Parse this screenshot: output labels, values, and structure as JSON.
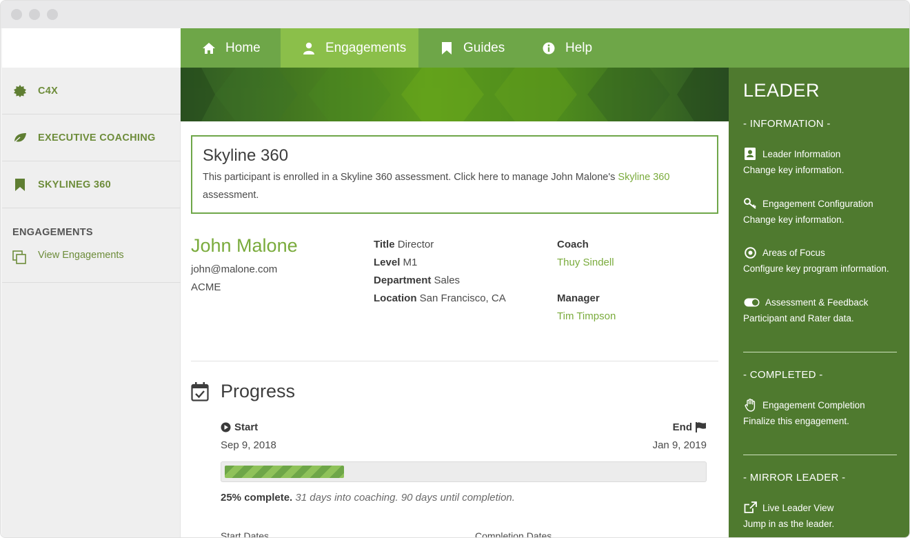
{
  "sidebar": {
    "items": [
      {
        "label": "C4X",
        "icon": "badge-icon"
      },
      {
        "label": "EXECUTIVE COACHING",
        "icon": "leaf-icon"
      },
      {
        "label": "SKYLINEG 360",
        "icon": "bookmark-icon"
      }
    ],
    "section_heading": "ENGAGEMENTS",
    "view_link": "View Engagements"
  },
  "nav": {
    "tabs": [
      {
        "label": "Home",
        "icon": "home-icon"
      },
      {
        "label": "Engagements",
        "icon": "user-icon",
        "active": true
      },
      {
        "label": "Guides",
        "icon": "bookmark-icon"
      },
      {
        "label": "Help",
        "icon": "info-icon"
      }
    ]
  },
  "notice": {
    "title": "Skyline 360",
    "text": "This participant is enrolled in a Skyline 360 assessment. Click here to manage John Malone's ",
    "link": "Skyline 360",
    "text_after": "assessment."
  },
  "person": {
    "name": "John Malone",
    "email": "john@malone.com",
    "company": "ACME",
    "fields": [
      {
        "key": "Title",
        "value": "Director"
      },
      {
        "key": "Level",
        "value": "M1"
      },
      {
        "key": "Department",
        "value": "Sales"
      },
      {
        "key": "Location",
        "value": "San Francisco, CA"
      }
    ],
    "coach_label": "Coach",
    "coach": "Thuy Sindell",
    "manager_label": "Manager",
    "manager": "Tim Timpson"
  },
  "progress": {
    "heading": "Progress",
    "start_label": "Start",
    "end_label": "End",
    "start_date": "Sep 9, 2018",
    "end_date": "Jan 9, 2019",
    "percent": 25,
    "percent_text": "25% complete.",
    "detail_text": "31 days into coaching. 90 days until completion.",
    "sub_left": "Start Dates",
    "sub_right": "Completion Dates"
  },
  "leader_panel": {
    "title": "LEADER",
    "sections": {
      "information": "- INFORMATION -",
      "completed": "- COMPLETED -",
      "mirror": "- MIRROR LEADER -"
    },
    "items": [
      {
        "label": "Leader Information",
        "desc": "Change key information.",
        "icon": "id-card-icon"
      },
      {
        "label": "Engagement Configuration",
        "desc": "Change key information.",
        "icon": "key-icon"
      },
      {
        "label": "Areas of Focus",
        "desc": "Configure key program information.",
        "icon": "target-icon"
      },
      {
        "label": "Assessment & Feedback",
        "desc": "Participant and Rater data.",
        "icon": "toggle-icon"
      },
      {
        "label": "Engagement Completion",
        "desc": "Finalize this engagement.",
        "icon": "hand-icon"
      },
      {
        "label": "Live Leader View",
        "desc": "Jump in as the leader.",
        "icon": "external-link-icon"
      }
    ]
  },
  "colors": {
    "nav_green": "#6ea648",
    "active_tab": "#8bbf4a",
    "panel_green": "#4f7a2f",
    "link_green": "#7aab3c"
  }
}
